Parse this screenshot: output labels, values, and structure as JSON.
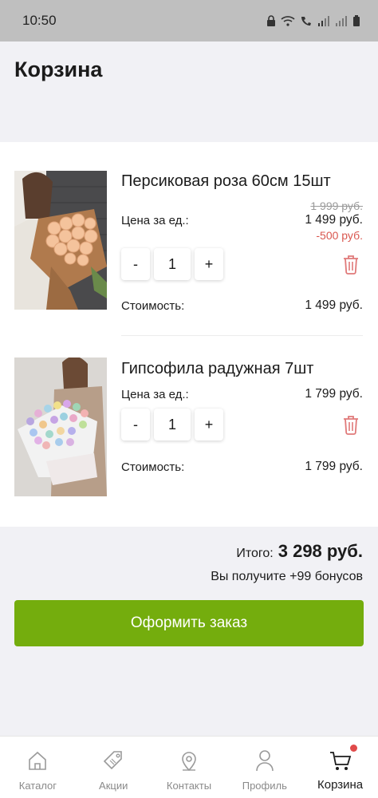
{
  "status_bar": {
    "time": "10:50"
  },
  "header": {
    "title": "Корзина"
  },
  "cart": {
    "items": [
      {
        "name": "Персиковая роза 60см 15шт",
        "price_label": "Цена за ед.:",
        "old_price": "1 999 руб.",
        "price": "1 499 руб.",
        "discount": "-500  руб.",
        "minus_label": "-",
        "quantity": "1",
        "plus_label": "+",
        "cost_label": "Стоимость:",
        "cost": "1 499 руб."
      },
      {
        "name": "Гипсофила радужная 7шт",
        "price_label": "Цена за ед.:",
        "price": "1 799 руб.",
        "minus_label": "-",
        "quantity": "1",
        "plus_label": "+",
        "cost_label": "Стоимость:",
        "cost": "1 799 руб."
      }
    ]
  },
  "summary": {
    "total_label": "Итого:",
    "total_value": "3 298 руб.",
    "bonus_text": "Вы получите +99 бонусов",
    "checkout_label": "Оформить заказ"
  },
  "bottom_nav": {
    "items": [
      {
        "label": "Каталог",
        "icon": "home-icon"
      },
      {
        "label": "Акции",
        "icon": "tag-icon"
      },
      {
        "label": "Контакты",
        "icon": "location-pin-icon"
      },
      {
        "label": "Профиль",
        "icon": "user-icon"
      },
      {
        "label": "Корзина",
        "icon": "cart-icon",
        "active": true,
        "has_notification": true
      }
    ]
  },
  "colors": {
    "accent": "#74ad0d",
    "discount": "#d9574f",
    "trash": "#e07a7a",
    "notification_dot": "#e04a4a"
  }
}
